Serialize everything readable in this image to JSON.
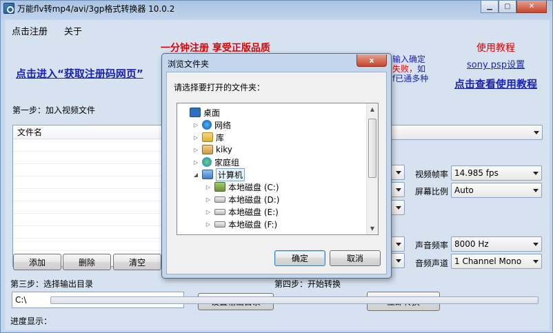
{
  "window": {
    "title": "万能flv转mp4/avi/3gp格式转换器 10.0.2"
  },
  "menu": {
    "items": [
      "点击注册",
      "关于"
    ]
  },
  "promo": {
    "headline": "一分钟注册  享受正版品质",
    "register_link": "点击进入“获取注册码网页”",
    "tutorial_label": "使用教程",
    "sony_link": "sony psp设置",
    "tutorial_link": "点击查看使用教程",
    "note_line1": "输入确定",
    "note_line2a": "失败，",
    "note_line2b": "如",
    "note_line3": "f已通多种"
  },
  "step1": {
    "label": "第一步：加入视频文件",
    "column_filename": "文件名"
  },
  "file_buttons": {
    "add": "添加",
    "delete": "删除",
    "clear": "清空"
  },
  "settings": {
    "frame_rate_label": "视频帧率",
    "frame_rate_value": "14.985 fps",
    "aspect_label": "屏幕比例",
    "aspect_value": "Auto",
    "sample_rate_label": "声音频率",
    "sample_rate_value": "8000 Hz",
    "channel_label": "音频声道",
    "channel_value": "1 Channel Mono"
  },
  "step3": {
    "label": "第三步：选择输出目录",
    "path": "C:\\",
    "set_button": "设置输出目录"
  },
  "step4": {
    "label": "第四步：开始转换",
    "convert_button": "立即转换"
  },
  "progress": {
    "label": "进度显示：",
    "value": 0
  },
  "dialog": {
    "title": "浏览文件夹",
    "close": "x",
    "prompt": "请选择要打开的文件夹：",
    "tree": [
      {
        "label": "桌面",
        "icon": "desktop-icon",
        "level": 0,
        "expander": ""
      },
      {
        "label": "网络",
        "icon": "network-icon",
        "level": 1,
        "expander": "▷"
      },
      {
        "label": "库",
        "icon": "library-icon",
        "level": 1,
        "expander": "▷"
      },
      {
        "label": "kiky",
        "icon": "user-folder-icon",
        "level": 1,
        "expander": "▷"
      },
      {
        "label": "家庭组",
        "icon": "homegroup-icon",
        "level": 1,
        "expander": "▷"
      },
      {
        "label": "计算机",
        "icon": "computer-icon",
        "level": 1,
        "expander": "◢",
        "selected": true
      },
      {
        "label": "本地磁盘 (C:)",
        "icon": "system-disk-icon",
        "level": 2,
        "expander": "▷"
      },
      {
        "label": "本地磁盘 (D:)",
        "icon": "disk-icon",
        "level": 2,
        "expander": "▷"
      },
      {
        "label": "本地磁盘 (E:)",
        "icon": "disk-icon",
        "level": 2,
        "expander": "▷"
      },
      {
        "label": "本地磁盘 (F:)",
        "icon": "disk-icon",
        "level": 2,
        "expander": "▷"
      }
    ],
    "ok": "确定",
    "cancel": "取消"
  }
}
